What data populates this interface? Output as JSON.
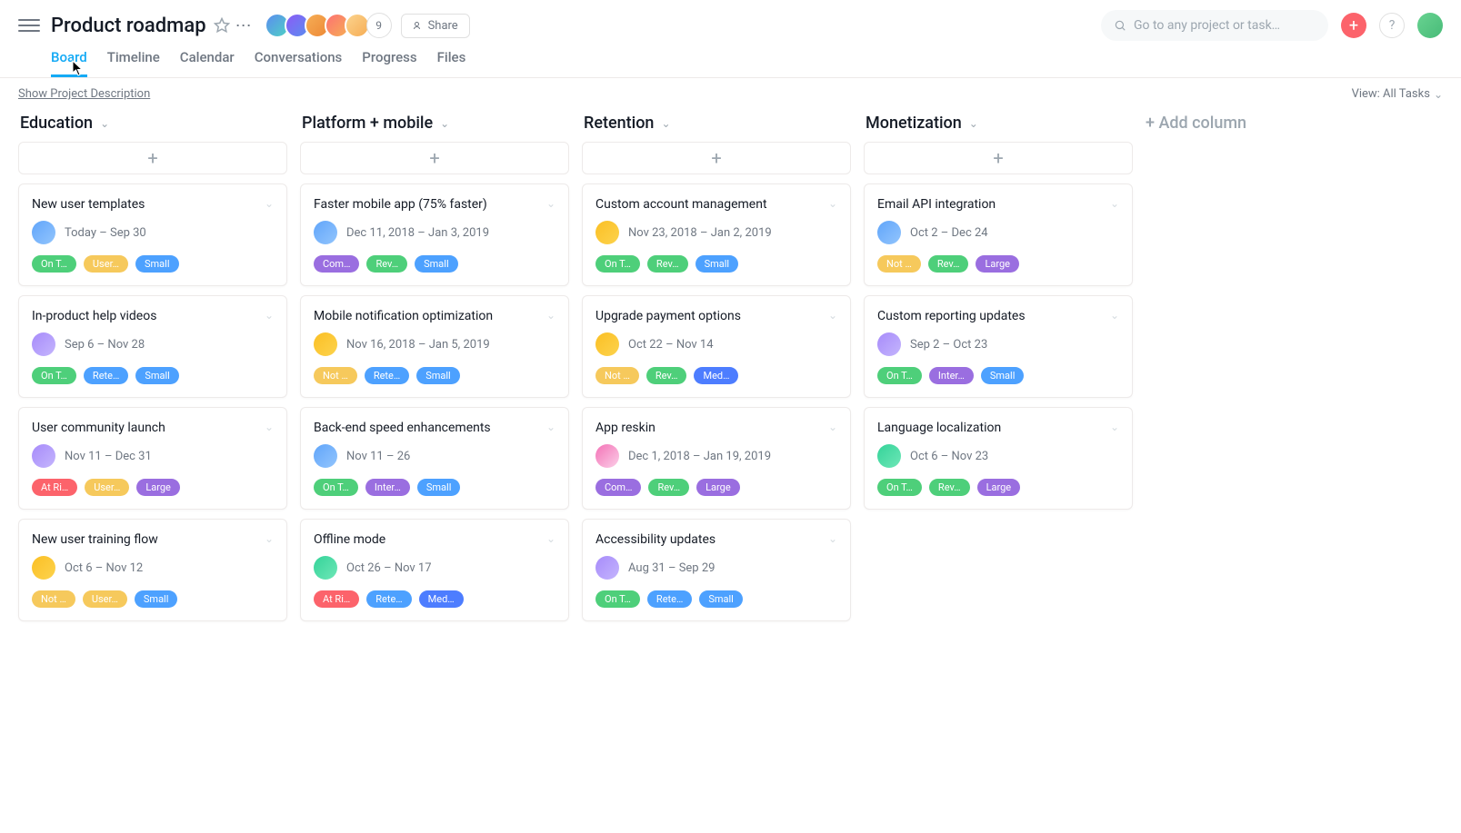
{
  "header": {
    "title": "Product roadmap",
    "more_count": "9",
    "share_label": "Share",
    "search_placeholder": "Go to any project or task…",
    "help": "?"
  },
  "tabs": [
    "Board",
    "Timeline",
    "Calendar",
    "Conversations",
    "Progress",
    "Files"
  ],
  "active_tab": 0,
  "subbar": {
    "show_desc": "Show Project Description",
    "view_label": "View: All Tasks"
  },
  "add_column_label": "+ Add column",
  "avatars": {
    "header": [
      "linear-gradient(135deg,#5b8def,#4fd1c5)",
      "linear-gradient(135deg,#8b5cf6,#5b8def)",
      "linear-gradient(135deg,#f6ad55,#ed8936)",
      "linear-gradient(135deg,#fd7272,#f6ad55)",
      "linear-gradient(135deg,#fbd38d,#f6ad55)"
    ],
    "profile": "linear-gradient(135deg,#68d391,#48bb78)"
  },
  "tag_colors": {
    "ontrack": "#4ecf7a",
    "user": "#f6c95c",
    "small": "#4da1ff",
    "atrisk": "#fc636b",
    "large": "#9a6ee0",
    "complete": "#9a6ee0",
    "rev": "#4ecf7a",
    "notstarted": "#f6c95c",
    "rete": "#4da1ff",
    "inter": "#9a6ee0",
    "medium": "#4d7dff"
  },
  "columns": [
    {
      "title": "Education",
      "cards": [
        {
          "title": "New user templates",
          "date": "Today – Sep 30",
          "avatar": "linear-gradient(135deg,#60a5fa,#93c5fd)",
          "tags": [
            {
              "t": "On T…",
              "c": "ontrack"
            },
            {
              "t": "User…",
              "c": "user"
            },
            {
              "t": "Small",
              "c": "small"
            }
          ]
        },
        {
          "title": "In-product help videos",
          "date": "Sep 6 – Nov 28",
          "avatar": "linear-gradient(135deg,#a78bfa,#c4b5fd)",
          "tags": [
            {
              "t": "On T…",
              "c": "ontrack"
            },
            {
              "t": "Rete…",
              "c": "rete"
            },
            {
              "t": "Small",
              "c": "small"
            }
          ]
        },
        {
          "title": "User community launch",
          "date": "Nov 11 – Dec 31",
          "avatar": "linear-gradient(135deg,#a78bfa,#c4b5fd)",
          "tags": [
            {
              "t": "At Ri…",
              "c": "atrisk"
            },
            {
              "t": "User…",
              "c": "user"
            },
            {
              "t": "Large",
              "c": "large"
            }
          ]
        },
        {
          "title": "New user training flow",
          "date": "Oct 6 – Nov 12",
          "avatar": "linear-gradient(135deg,#fbbf24,#fcd34d)",
          "tags": [
            {
              "t": "Not …",
              "c": "notstarted"
            },
            {
              "t": "User…",
              "c": "user"
            },
            {
              "t": "Small",
              "c": "small"
            }
          ]
        }
      ]
    },
    {
      "title": "Platform + mobile",
      "cards": [
        {
          "title": "Faster mobile app (75% faster)",
          "date": "Dec 11, 2018 – Jan 3, 2019",
          "avatar": "linear-gradient(135deg,#60a5fa,#93c5fd)",
          "tags": [
            {
              "t": "Com…",
              "c": "complete"
            },
            {
              "t": "Rev…",
              "c": "rev"
            },
            {
              "t": "Small",
              "c": "small"
            }
          ]
        },
        {
          "title": "Mobile notification optimization",
          "date": "Nov 16, 2018 – Jan 5, 2019",
          "avatar": "linear-gradient(135deg,#fbbf24,#fcd34d)",
          "tags": [
            {
              "t": "Not …",
              "c": "notstarted"
            },
            {
              "t": "Rete…",
              "c": "rete"
            },
            {
              "t": "Small",
              "c": "small"
            }
          ]
        },
        {
          "title": "Back-end speed enhancements",
          "date": "Nov 11 – 26",
          "avatar": "linear-gradient(135deg,#60a5fa,#93c5fd)",
          "tags": [
            {
              "t": "On T…",
              "c": "ontrack"
            },
            {
              "t": "Inter…",
              "c": "inter"
            },
            {
              "t": "Small",
              "c": "small"
            }
          ]
        },
        {
          "title": "Offline mode",
          "date": "Oct 26 – Nov 17",
          "avatar": "linear-gradient(135deg,#34d399,#6ee7b7)",
          "tags": [
            {
              "t": "At Ri…",
              "c": "atrisk"
            },
            {
              "t": "Rete…",
              "c": "rete"
            },
            {
              "t": "Med…",
              "c": "medium"
            }
          ]
        }
      ]
    },
    {
      "title": "Retention",
      "cards": [
        {
          "title": "Custom account management",
          "date": "Nov 23, 2018 – Jan 2, 2019",
          "avatar": "linear-gradient(135deg,#fbbf24,#fcd34d)",
          "tags": [
            {
              "t": "On T…",
              "c": "ontrack"
            },
            {
              "t": "Rev…",
              "c": "rev"
            },
            {
              "t": "Small",
              "c": "small"
            }
          ]
        },
        {
          "title": "Upgrade payment options",
          "date": "Oct 22 – Nov 14",
          "avatar": "linear-gradient(135deg,#fbbf24,#fcd34d)",
          "tags": [
            {
              "t": "Not …",
              "c": "notstarted"
            },
            {
              "t": "Rev…",
              "c": "rev"
            },
            {
              "t": "Med…",
              "c": "medium"
            }
          ]
        },
        {
          "title": "App reskin",
          "date": "Dec 1, 2018 – Jan 19, 2019",
          "avatar": "linear-gradient(135deg,#f472b6,#fbcfe8)",
          "tags": [
            {
              "t": "Com…",
              "c": "complete"
            },
            {
              "t": "Rev…",
              "c": "rev"
            },
            {
              "t": "Large",
              "c": "large"
            }
          ]
        },
        {
          "title": "Accessibility updates",
          "date": "Aug 31 – Sep 29",
          "avatar": "linear-gradient(135deg,#a78bfa,#c4b5fd)",
          "tags": [
            {
              "t": "On T…",
              "c": "ontrack"
            },
            {
              "t": "Rete…",
              "c": "rete"
            },
            {
              "t": "Small",
              "c": "small"
            }
          ]
        }
      ]
    },
    {
      "title": "Monetization",
      "cards": [
        {
          "title": "Email API integration",
          "date": "Oct 2 – Dec 24",
          "avatar": "linear-gradient(135deg,#60a5fa,#93c5fd)",
          "tags": [
            {
              "t": "Not …",
              "c": "notstarted"
            },
            {
              "t": "Rev…",
              "c": "rev"
            },
            {
              "t": "Large",
              "c": "large"
            }
          ]
        },
        {
          "title": "Custom reporting updates",
          "date": "Sep 2 – Oct 23",
          "avatar": "linear-gradient(135deg,#a78bfa,#c4b5fd)",
          "tags": [
            {
              "t": "On T…",
              "c": "ontrack"
            },
            {
              "t": "Inter…",
              "c": "inter"
            },
            {
              "t": "Small",
              "c": "small"
            }
          ]
        },
        {
          "title": "Language localization",
          "date": "Oct 6 – Nov 23",
          "avatar": "linear-gradient(135deg,#34d399,#6ee7b7)",
          "tags": [
            {
              "t": "On T…",
              "c": "ontrack"
            },
            {
              "t": "Rev…",
              "c": "rev"
            },
            {
              "t": "Large",
              "c": "large"
            }
          ]
        }
      ]
    }
  ]
}
